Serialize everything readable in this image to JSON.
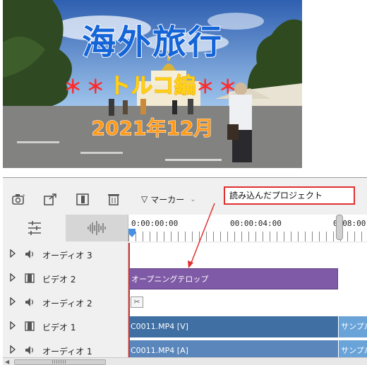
{
  "preview": {
    "title": "海外旅行",
    "subtitle_left_stars": "＊＊",
    "subtitle": "トルコ編",
    "subtitle_right_stars": "＊＊",
    "date": "2021年12月"
  },
  "toolbar": {
    "marker_icon": "▽",
    "marker_label": "マーカー",
    "marker_chevron": "⌄",
    "icons": [
      "camera-icon",
      "export-icon",
      "clip-icon",
      "trash-icon"
    ]
  },
  "annotation": {
    "callout": "読み込んだプロジェクト"
  },
  "ruler": {
    "labels": [
      "0:00:00:00",
      "00:00:04:00",
      "0:08:00"
    ]
  },
  "tracks": [
    {
      "name": "オーディオ 3",
      "type": "audio"
    },
    {
      "name": "ビデオ 2",
      "type": "video"
    },
    {
      "name": "オーディオ 2",
      "type": "audio"
    },
    {
      "name": "ビデオ 1",
      "type": "video"
    },
    {
      "name": "オーディオ 1",
      "type": "audio"
    }
  ],
  "clips": {
    "opening_telop": "オープニングテロップ",
    "video1_main": "C0011.MP4 [V]",
    "video1_sample": "サンプル",
    "audio1_main": "C0011.MP4 [A]",
    "audio1_sample": "サンプル"
  },
  "colors": {
    "title_blue": "#1565d8",
    "subtitle_yellow": "#ffd21a",
    "date_orange": "#ff9a1a",
    "telop_clip": "#7f5aa6",
    "video_clip": "#3f6fa3",
    "callout_red": "#e03030"
  }
}
